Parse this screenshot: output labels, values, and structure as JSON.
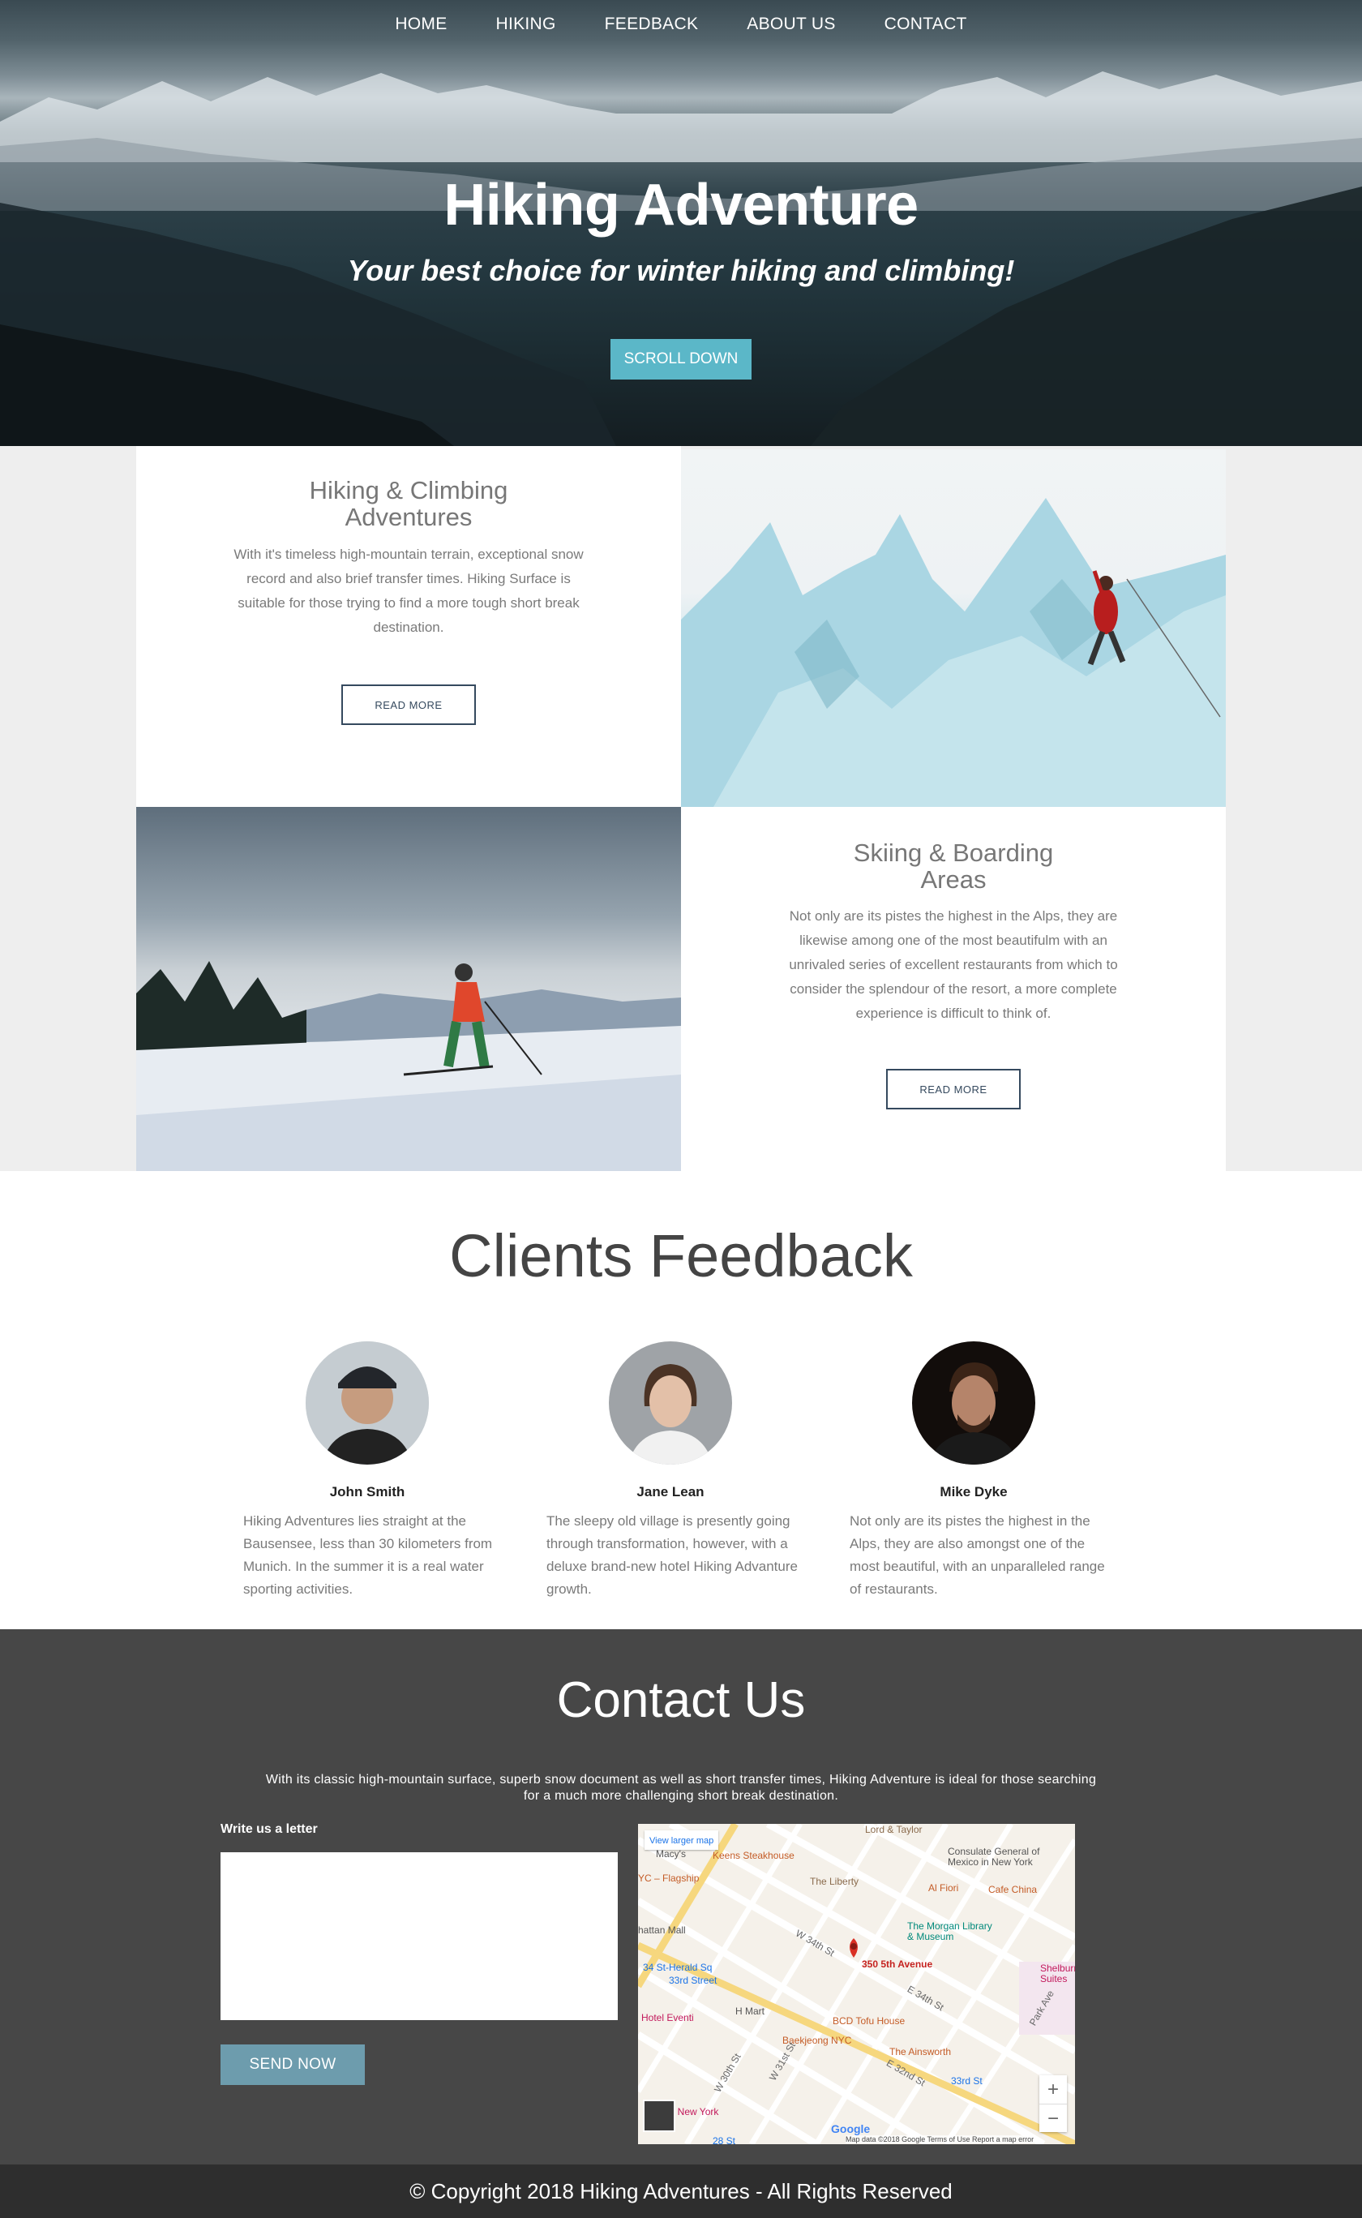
{
  "nav": [
    "HOME",
    "HIKING",
    "FEEDBACK",
    "ABOUT US",
    "CONTACT"
  ],
  "hero": {
    "title": "Hiking Adventure",
    "subtitle": "Your best choice for winter hiking and climbing!",
    "button": "SCROLL DOWN"
  },
  "features": [
    {
      "title_line1": "Hiking & Climbing",
      "title_line2": "Adventures",
      "text": "With it's timeless high-mountain terrain, exceptional snow record and also brief transfer times. Hiking Surface is suitable for those trying to find a more tough short break destination.",
      "button": "READ MORE"
    },
    {
      "title_line1": "Skiing & Boarding",
      "title_line2": "Areas",
      "text": "Not only are its pistes the highest in the Alps, they are likewise among one of the most beautifulm with an unrivaled series of excellent restaurants from which to consider the splendour of the resort, a more complete experience is difficult to think of.",
      "button": "READ MORE"
    }
  ],
  "feedback": {
    "heading": "Clients Feedback",
    "clients": [
      {
        "name": "John Smith",
        "text": "Hiking Adventures lies straight at the Bausensee, less than 30 kilometers from Munich. In the summer it is a real water sporting activities."
      },
      {
        "name": "Jane Lean",
        "text": "The sleepy old village is presently going through transformation, however, with a deluxe brand-new hotel Hiking Advanture growth."
      },
      {
        "name": "Mike Dyke",
        "text": "Not only are its pistes the highest in the Alps, they are also amongst one of the most beautiful, with an unparalleled range of restaurants."
      }
    ]
  },
  "contact": {
    "heading": "Contact Us",
    "intro": "With its classic high-mountain surface, superb snow document as well as short transfer times, Hiking Adventure is ideal for those searching for a much more challenging short break destination.",
    "label": "Write us a letter",
    "button": "SEND NOW"
  },
  "map": {
    "view_larger": "View larger map",
    "pin_label": "350 5th Avenue",
    "places": [
      "Lord & Taylor",
      "Macy's",
      "Keens Steakhouse",
      "Consulate General of Mexico in New York",
      "The Liberty",
      "Al Fiori",
      "Cafe China",
      "YC – Flagship",
      "hattan Mall",
      "The Morgan Library & Museum",
      "34 St-Herald Sq",
      "33rd Street",
      "W 34th St",
      "H Mart",
      "Hotel Eventi",
      "BCD Tofu House",
      "Baekjeong NYC",
      "The Ainsworth",
      "33rd St",
      "el New York",
      "28 St",
      "Shelburne Suites",
      "Park Ave",
      "E 32nd St",
      "W 30th St",
      "W 31st St",
      "E 34th St"
    ],
    "zoom_in": "+",
    "zoom_out": "−",
    "attribution": "Map data ©2018 Google   Terms of Use   Report a map error",
    "brand": "Google"
  },
  "footer": "© Copyright 2018 Hiking Adventures - All Rights Reserved"
}
